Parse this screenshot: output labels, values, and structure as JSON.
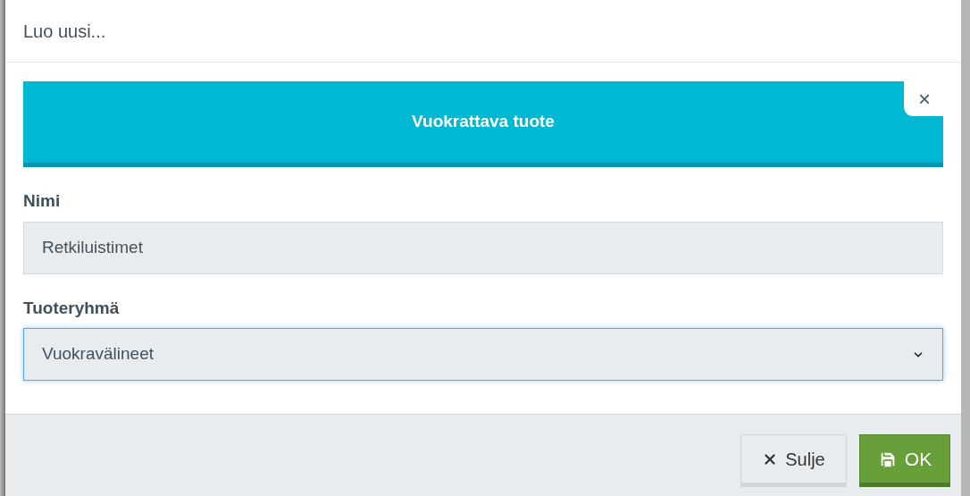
{
  "dialog": {
    "title": "Luo uusi...",
    "banner": {
      "title": "Vuokrattava tuote",
      "close": "×"
    },
    "fields": [
      {
        "kind": "text",
        "label": "Nimi",
        "value": "Retkiluistimet",
        "focused": false
      },
      {
        "kind": "select",
        "label": "Tuoteryhmä",
        "value": "Vuokravälineet",
        "focused": true
      }
    ],
    "buttons": [
      {
        "kind": "close",
        "label": "Sulje"
      },
      {
        "kind": "ok",
        "label": "OK"
      }
    ]
  }
}
